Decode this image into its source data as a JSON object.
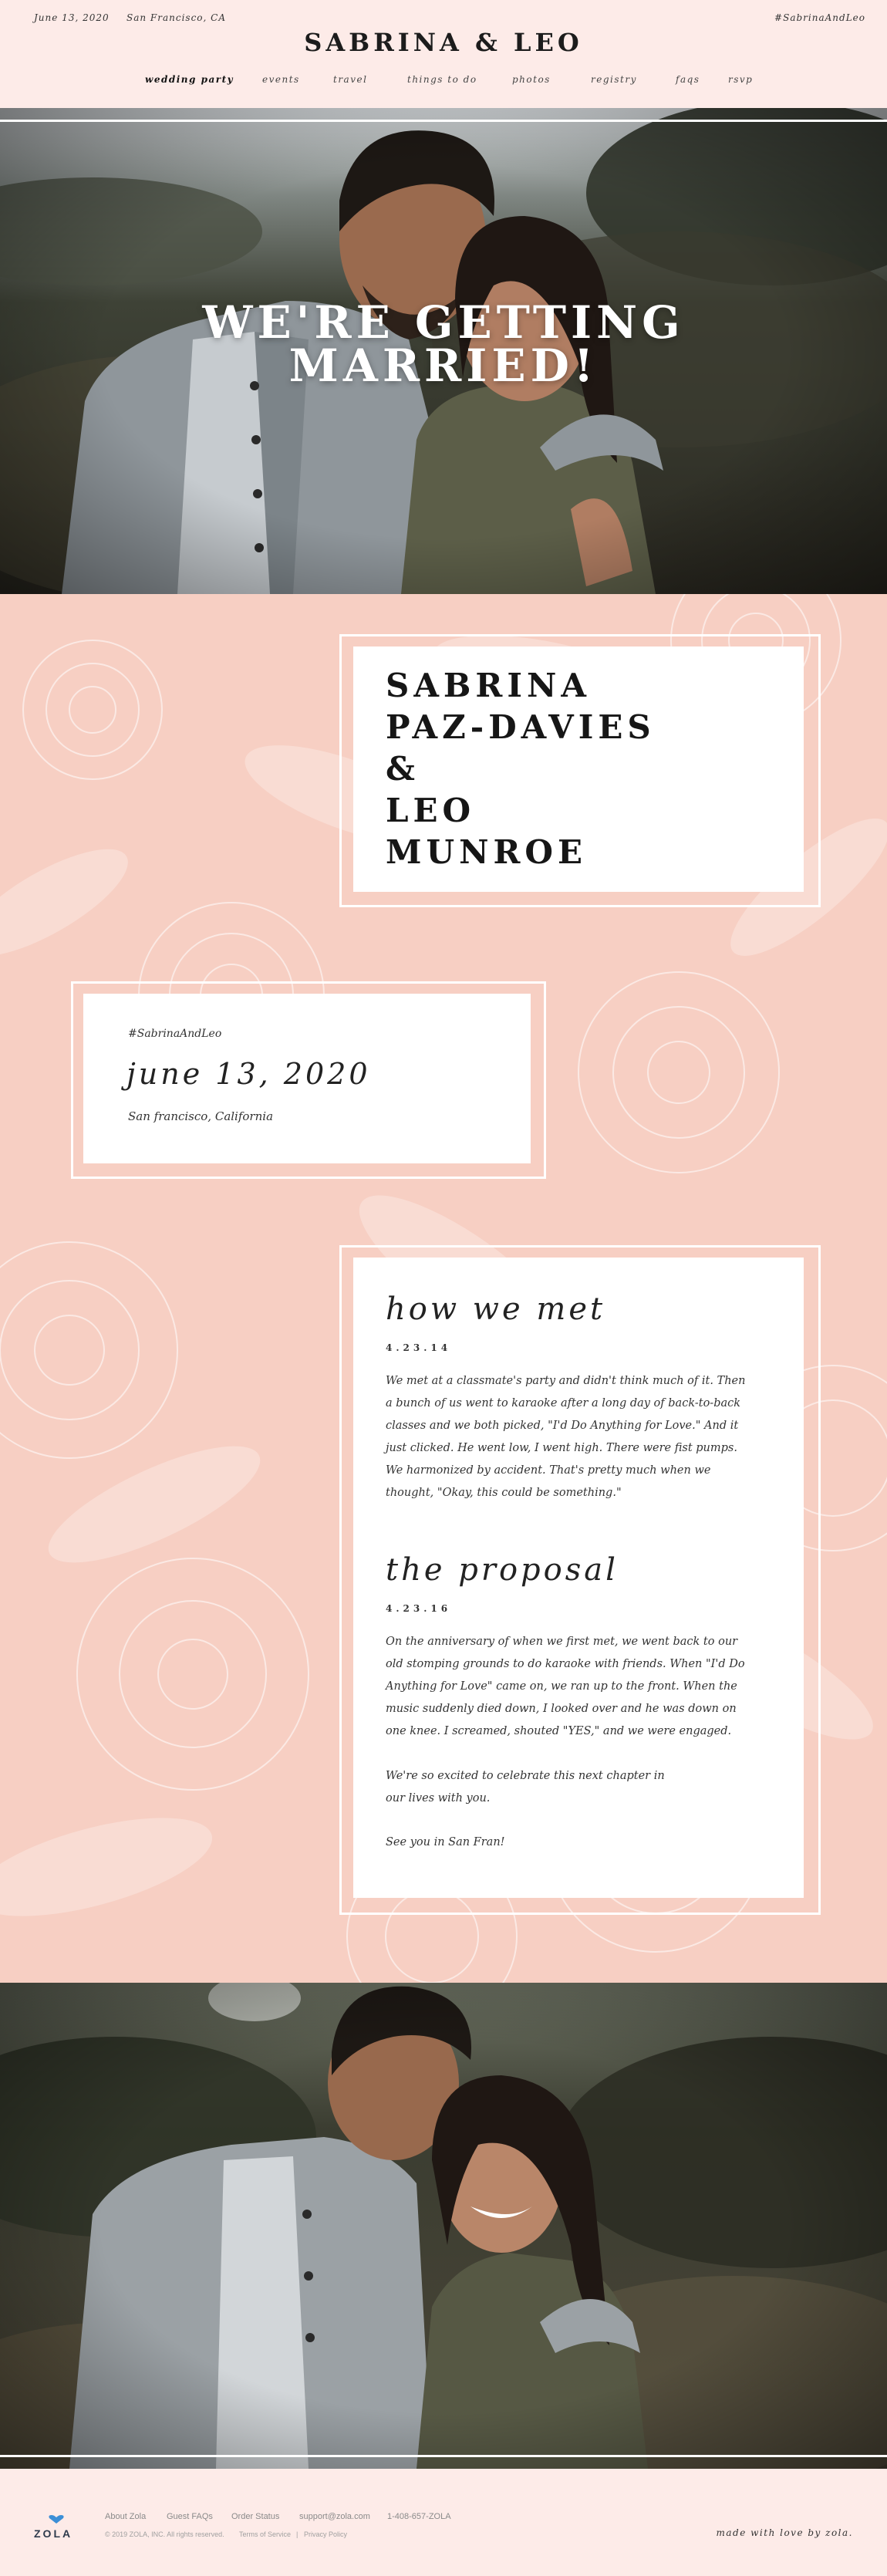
{
  "header": {
    "date": "June 13, 2020",
    "location": "San Francisco, CA",
    "hashtag": "#SabrinaAndLeo",
    "title": "SABRINA & LEO",
    "nav": [
      {
        "label": "wedding party",
        "active": true
      },
      {
        "label": "events"
      },
      {
        "label": "travel"
      },
      {
        "label": "things to do"
      },
      {
        "label": "photos"
      },
      {
        "label": "registry"
      },
      {
        "label": "faqs"
      },
      {
        "label": "rsvp"
      }
    ]
  },
  "hero": {
    "title_line1": "WE'RE GETTING",
    "title_line2": "MARRIED!"
  },
  "couple": {
    "line1": "SABRINA",
    "line2": "PAZ-DAVIES",
    "line3": "&",
    "line4": "LEO",
    "line5": "MUNROE"
  },
  "details": {
    "hashtag": "#SabrinaAndLeo",
    "date": "june 13, 2020",
    "location": "San francisco, California"
  },
  "story": {
    "met_title": "how we met",
    "met_date": "4.23.14",
    "met_text": "We met at a classmate's party and didn't think much of it. Then a bunch of us went to karaoke after a long day of back-to-back classes and we both picked, \"I'd Do Anything for Love.\" And it just clicked. He went low, I went high. There were fist pumps. We harmonized by accident. That's pretty much when we thought, \"Okay, this could be something.\"",
    "proposal_title": "the proposal",
    "proposal_date": "4.23.16",
    "proposal_text": "On the anniversary of when we first met, we went back to our old stomping grounds to do karaoke with friends. When \"I'd Do Anything for Love\" came on, we ran up to the front. When the music suddenly died down, I looked over and he was down on one knee. I screamed, shouted \"YES,\" and we were engaged.",
    "excited_text": "We're so excited to celebrate this next chapter in our lives with you.",
    "closing": "See you in San Fran!"
  },
  "footer": {
    "logo_text": "ZOLA",
    "links": [
      "About Zola",
      "Guest FAQs",
      "Order Status",
      "support@zola.com",
      "1-408-657-ZOLA"
    ],
    "copyright": "© 2019 ZOLA, INC. All rights reserved.",
    "terms": "Terms of Service",
    "separator": "|",
    "privacy": "Privacy Policy",
    "made_with": "made with love by zola."
  }
}
